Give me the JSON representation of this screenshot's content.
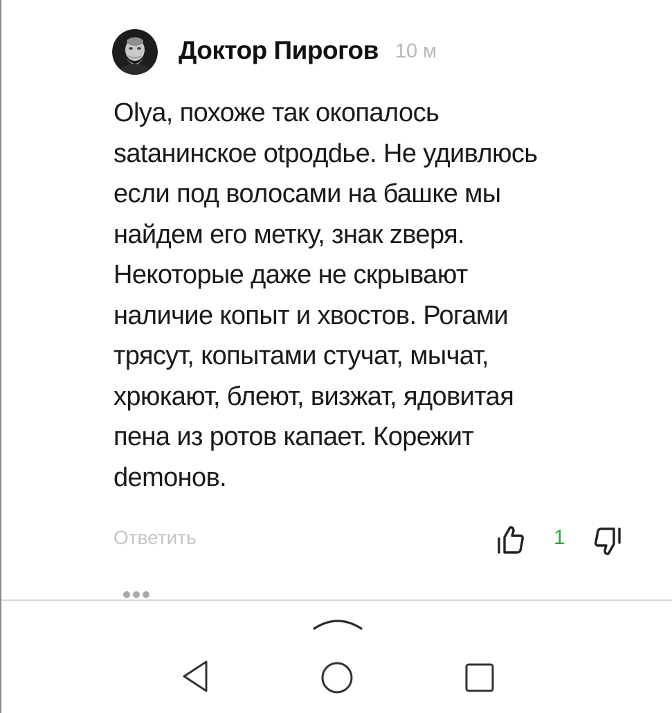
{
  "comment": {
    "author": "Доктор Пирогов",
    "time": "10 м",
    "text": "Olya, похоже так окопалось\nsataнинское otpoдdье. Не удивлюсь\nесли под волосами на башке мы\nнайдем его метку, знак zверя.\nНекоторые даже не скрывают\nналичие копыт и хвостов. Рогами\nтрясут, копытами стучат, мычат,\nхрюкают, блеют, визжат, ядовитая\nпена из ротов капает. Корежит\ndemoнов.",
    "reply_label": "Ответить",
    "likes": "1",
    "avatar_icon": "portrait-avatar"
  },
  "colors": {
    "author_text": "#111111",
    "muted_text": "#b8b8b8",
    "like_green": "#2fa83a"
  },
  "navigation": {
    "handle_icon": "chevron-up-icon",
    "back_icon": "triangle-back-icon",
    "home_icon": "circle-home-icon",
    "recents_icon": "square-recents-icon"
  }
}
